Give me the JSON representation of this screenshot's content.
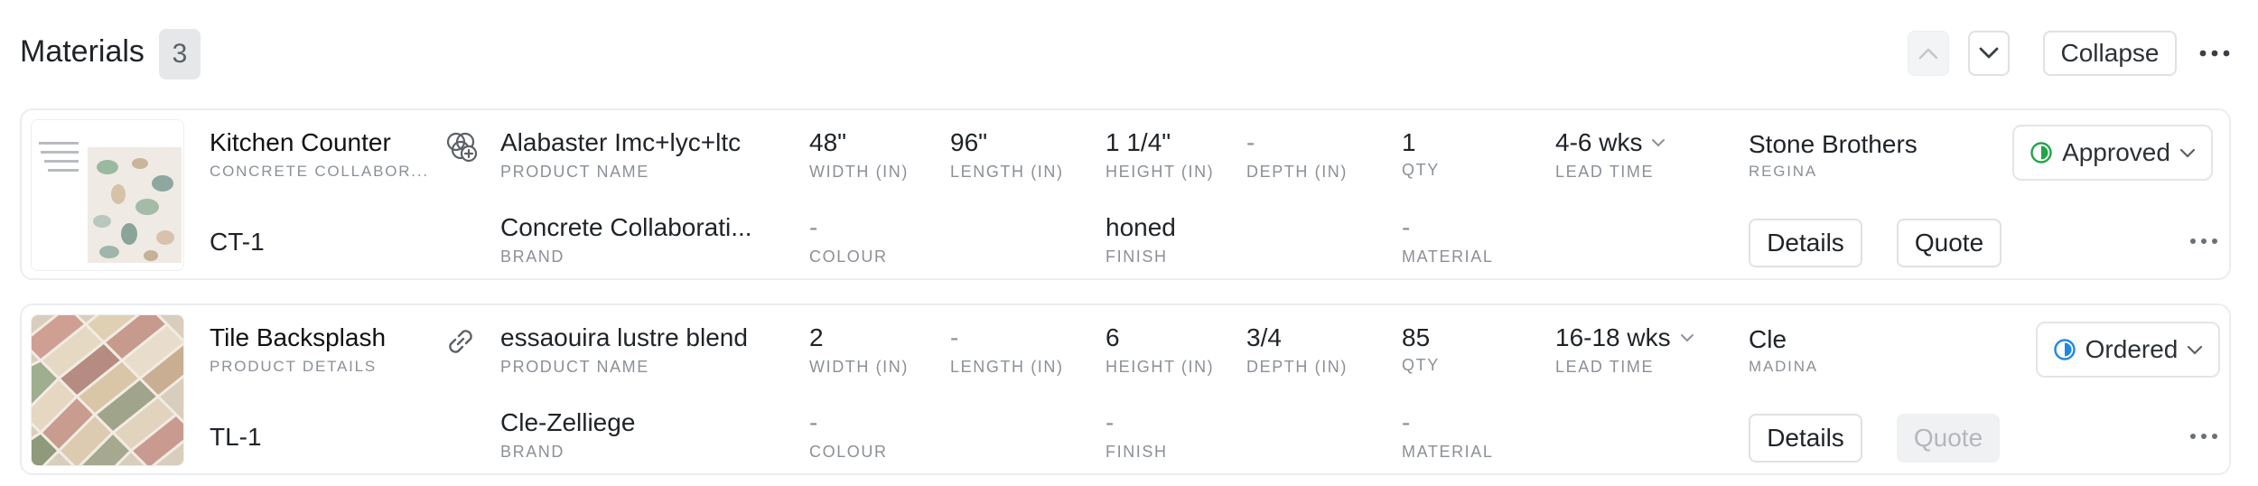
{
  "header": {
    "title": "Materials",
    "count": "3",
    "collapse_label": "Collapse"
  },
  "labels": {
    "product_name": "PRODUCT NAME",
    "brand": "BRAND",
    "width": "WIDTH (IN)",
    "length": "LENGTH (IN)",
    "height": "HEIGHT (IN)",
    "depth": "DEPTH (IN)",
    "colour": "COLOUR",
    "finish": "FINISH",
    "qty": "QTY",
    "material": "MATERIAL",
    "lead_time": "LEAD TIME"
  },
  "items": [
    {
      "name": "Kitchen Counter",
      "subtitle": "CONCRETE COLLABOR...",
      "code": "CT-1",
      "product_name": "Alabaster Imc+lyc+ltc",
      "brand": "Concrete Collaborati...",
      "width": "48\"",
      "length": "96\"",
      "height": "1 1/4\"",
      "depth": "-",
      "colour": "-",
      "finish": "honed",
      "qty": "1",
      "material": "-",
      "lead_time": "4-6 wks",
      "vendor": "Stone Brothers",
      "vendor_contact": "REGINA",
      "status": "Approved",
      "status_color": "#22a447",
      "details_label": "Details",
      "quote_label": "Quote",
      "quote_enabled": true,
      "link_icon": "add-link-icon"
    },
    {
      "name": "Tile Backsplash",
      "subtitle": "PRODUCT DETAILS",
      "code": "TL-1",
      "product_name": "essaouira lustre blend",
      "brand": "Cle-Zelliege",
      "width": "2",
      "length": "-",
      "height": "6",
      "depth": "3/4",
      "colour": "-",
      "finish": "-",
      "qty": "85",
      "material": "-",
      "lead_time": "16-18 wks",
      "vendor": "Cle",
      "vendor_contact": "MADINA",
      "status": "Ordered",
      "status_color": "#1e88e5",
      "details_label": "Details",
      "quote_label": "Quote",
      "quote_enabled": false,
      "link_icon": "link-icon"
    }
  ]
}
